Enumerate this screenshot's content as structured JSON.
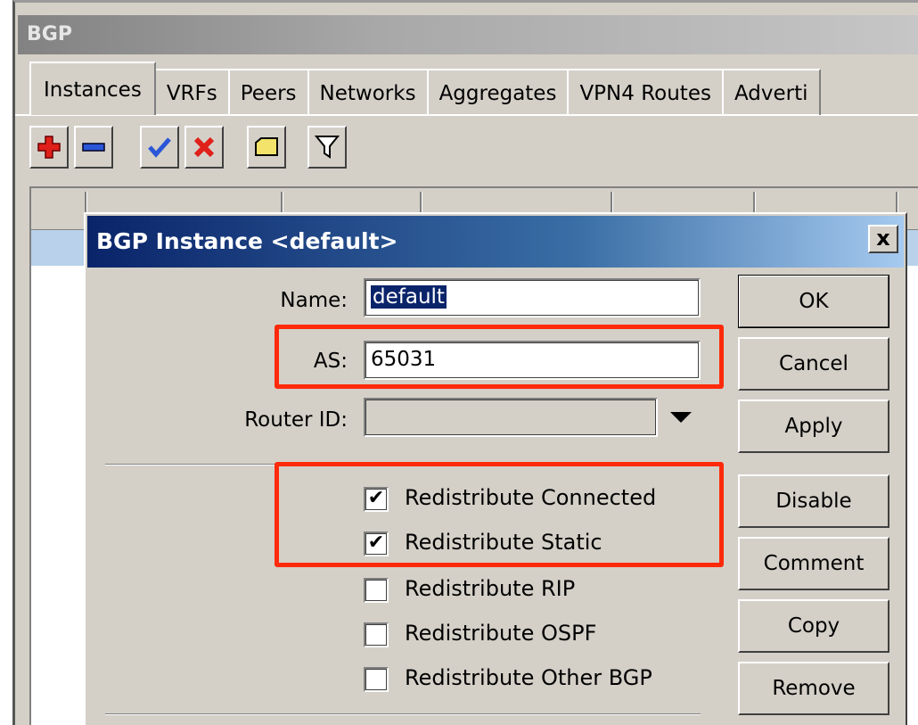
{
  "window": {
    "title": "BGP"
  },
  "tabs": [
    "Instances",
    "VRFs",
    "Peers",
    "Networks",
    "Aggregates",
    "VPN4 Routes",
    "Adverti"
  ],
  "toolbar": {
    "add_icon": "plus-icon",
    "remove_icon": "minus-icon",
    "enable_icon": "check-icon",
    "disable_icon": "x-icon",
    "comment_icon": "note-icon",
    "filter_icon": "filter-icon"
  },
  "dialog": {
    "title": "BGP Instance <default>",
    "close": "x",
    "fields": {
      "name_label": "Name:",
      "name_value": "default",
      "as_label": "AS:",
      "as_value": "65031",
      "router_id_label": "Router ID:",
      "router_id_value": ""
    },
    "checkboxes": [
      {
        "label": "Redistribute Connected",
        "checked": true
      },
      {
        "label": "Redistribute Static",
        "checked": true
      },
      {
        "label": "Redistribute RIP",
        "checked": false
      },
      {
        "label": "Redistribute OSPF",
        "checked": false
      },
      {
        "label": "Redistribute Other BGP",
        "checked": false
      }
    ],
    "buttons": {
      "ok": "OK",
      "cancel": "Cancel",
      "apply": "Apply",
      "disable": "Disable",
      "comment": "Comment",
      "copy": "Copy",
      "remove": "Remove"
    }
  },
  "colors": {
    "highlight": "#ff2a0a",
    "title_bar": "#0a246a",
    "selected_row": "#b9d1ea"
  }
}
